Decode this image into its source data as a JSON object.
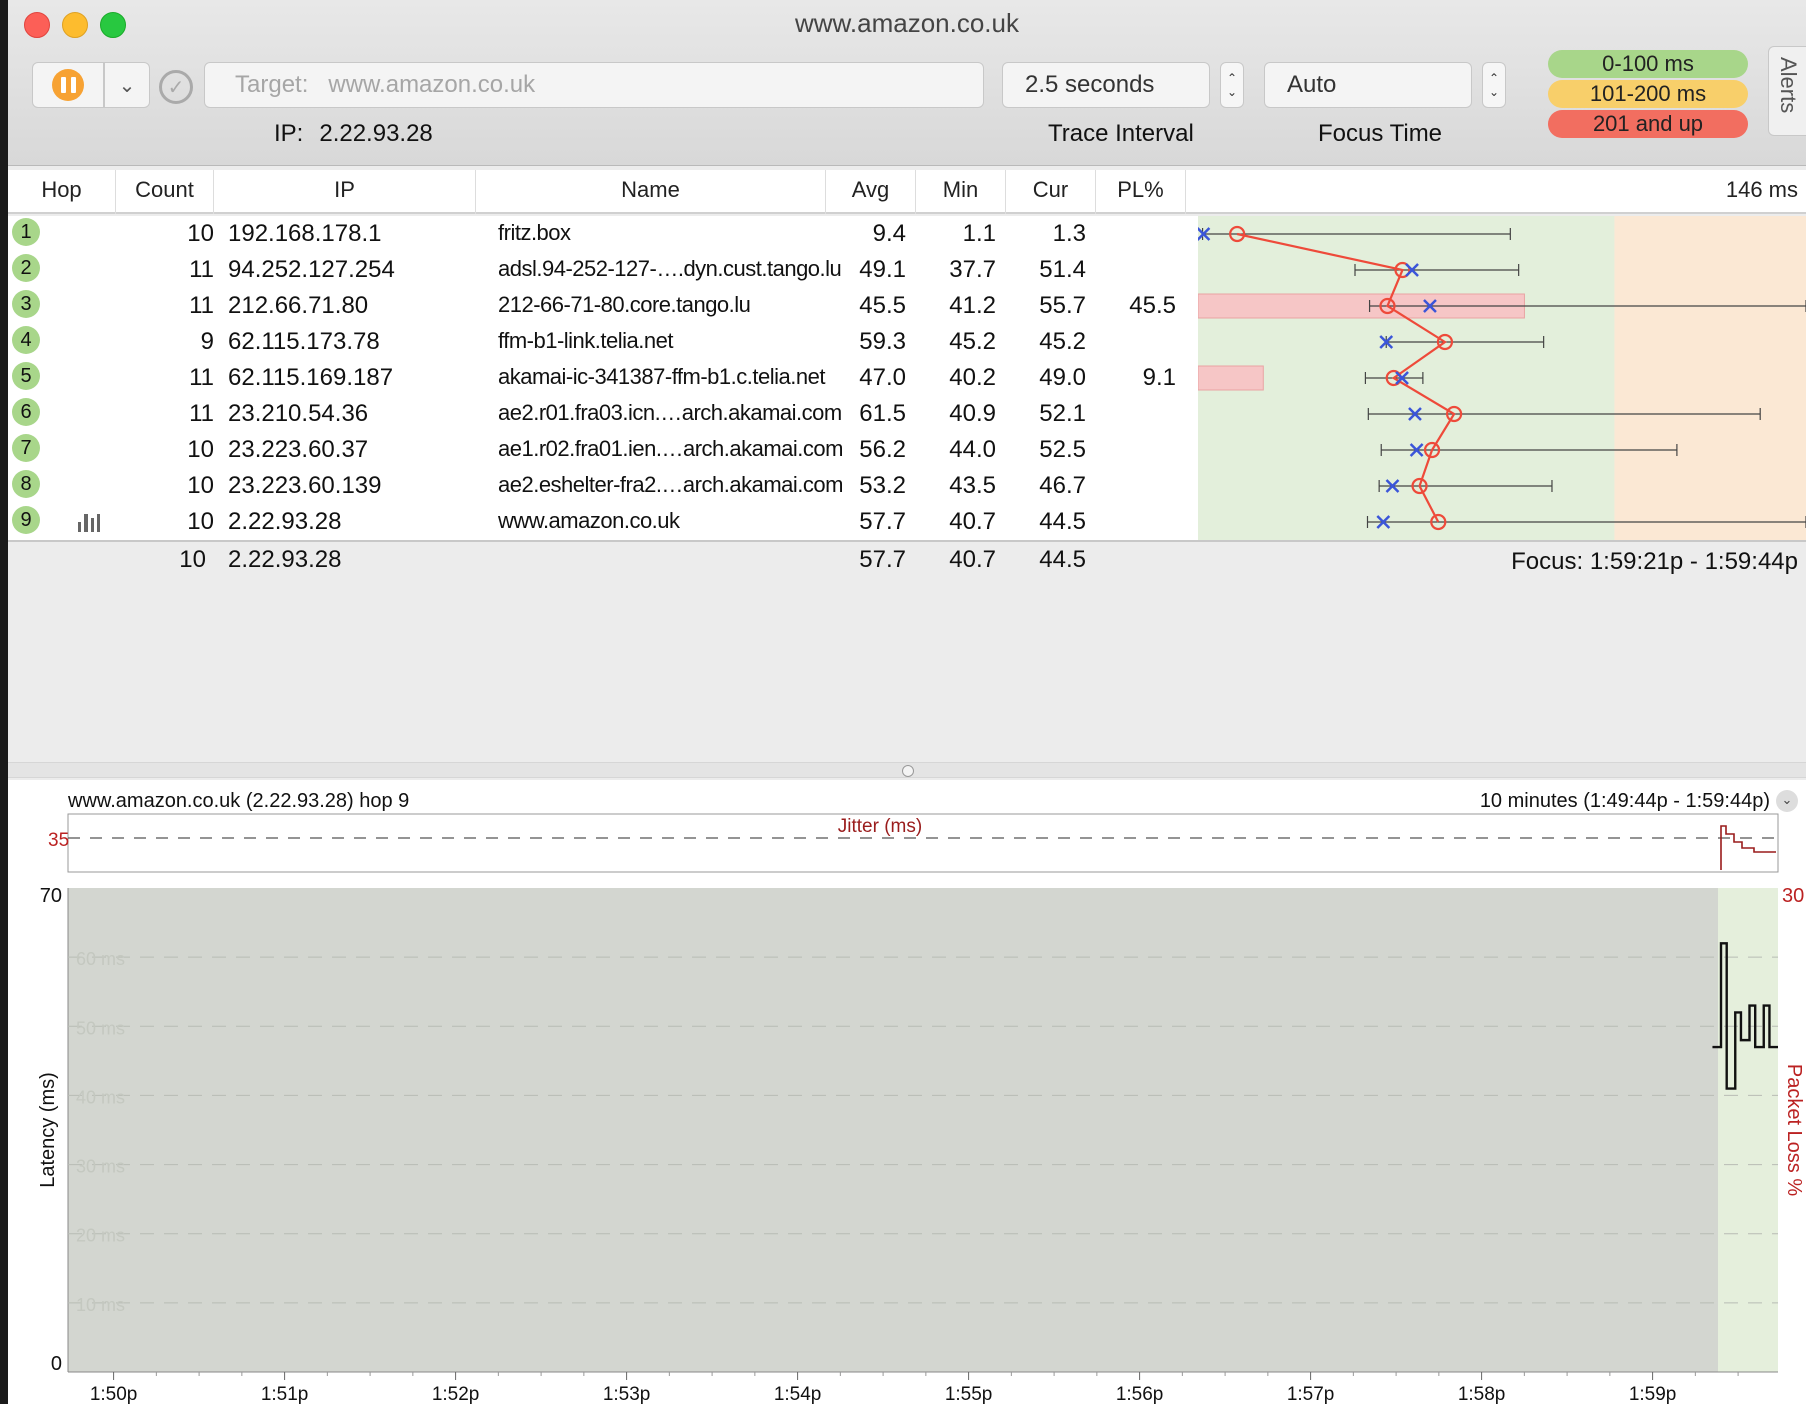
{
  "window": {
    "title": "www.amazon.co.uk"
  },
  "toolbar": {
    "target_label": "Target:",
    "target_value": "www.amazon.co.uk",
    "ip_label": "IP:",
    "ip_value": "2.22.93.28",
    "interval_value": "2.5 seconds",
    "interval_caption": "Trace Interval",
    "focus_value": "Auto",
    "focus_caption": "Focus Time",
    "legend": [
      "0-100 ms",
      "101-200 ms",
      "201 and up"
    ],
    "alerts_label": "Alerts",
    "legend_colors": {
      "good": "#a8d68a",
      "warn": "#f8cf6a",
      "bad": "#f26e60"
    }
  },
  "table": {
    "headers": [
      "Hop",
      "Count",
      "IP",
      "Name",
      "Avg",
      "Min",
      "Cur",
      "PL%"
    ],
    "scale_max_label": "146 ms",
    "rows": [
      {
        "hop": "1",
        "count": "10",
        "ip": "192.168.178.1",
        "name": "fritz.box",
        "avg": "9.4",
        "min": "1.1",
        "cur": "1.3",
        "pl": ""
      },
      {
        "hop": "2",
        "count": "11",
        "ip": "94.252.127.254",
        "name": "adsl.94-252-127-….dyn.cust.tango.lu",
        "avg": "49.1",
        "min": "37.7",
        "cur": "51.4",
        "pl": ""
      },
      {
        "hop": "3",
        "count": "11",
        "ip": "212.66.71.80",
        "name": "212-66-71-80.core.tango.lu",
        "avg": "45.5",
        "min": "41.2",
        "cur": "55.7",
        "pl": "45.5"
      },
      {
        "hop": "4",
        "count": "9",
        "ip": "62.115.173.78",
        "name": "ffm-b1-link.telia.net",
        "avg": "59.3",
        "min": "45.2",
        "cur": "45.2",
        "pl": ""
      },
      {
        "hop": "5",
        "count": "11",
        "ip": "62.115.169.187",
        "name": "akamai-ic-341387-ffm-b1.c.telia.net",
        "avg": "47.0",
        "min": "40.2",
        "cur": "49.0",
        "pl": "9.1"
      },
      {
        "hop": "6",
        "count": "11",
        "ip": "23.210.54.36",
        "name": "ae2.r01.fra03.icn.…arch.akamai.com",
        "avg": "61.5",
        "min": "40.9",
        "cur": "52.1",
        "pl": ""
      },
      {
        "hop": "7",
        "count": "10",
        "ip": "23.223.60.37",
        "name": "ae1.r02.fra01.ien.…arch.akamai.com",
        "avg": "56.2",
        "min": "44.0",
        "cur": "52.5",
        "pl": ""
      },
      {
        "hop": "8",
        "count": "10",
        "ip": "23.223.60.139",
        "name": "ae2.eshelter-fra2.…arch.akamai.com",
        "avg": "53.2",
        "min": "43.5",
        "cur": "46.7",
        "pl": ""
      },
      {
        "hop": "9",
        "count": "10",
        "ip": "2.22.93.28",
        "name": "www.amazon.co.uk",
        "avg": "57.7",
        "min": "40.7",
        "cur": "44.5",
        "pl": ""
      }
    ],
    "summary": {
      "count": "10",
      "ip": "2.22.93.28",
      "avg": "57.7",
      "min": "40.7",
      "cur": "44.5"
    },
    "focus_range": "Focus: 1:59:21p - 1:59:44p",
    "graph": {
      "scale_max_ms": 146,
      "green_until_ms": 100,
      "hops": [
        {
          "min": 1.1,
          "avg": 9.4,
          "cur": 1.3,
          "max": 75,
          "pl": 0
        },
        {
          "min": 37.7,
          "avg": 49.1,
          "cur": 51.4,
          "max": 77,
          "pl": 0
        },
        {
          "min": 41.2,
          "avg": 45.5,
          "cur": 55.7,
          "max": 146,
          "pl": 45.5
        },
        {
          "min": 45.2,
          "avg": 59.3,
          "cur": 45.2,
          "max": 83,
          "pl": 0
        },
        {
          "min": 40.2,
          "avg": 47.0,
          "cur": 49.0,
          "max": 54,
          "pl": 9.1
        },
        {
          "min": 40.9,
          "avg": 61.5,
          "cur": 52.1,
          "max": 135,
          "pl": 0
        },
        {
          "min": 44.0,
          "avg": 56.2,
          "cur": 52.5,
          "max": 115,
          "pl": 0
        },
        {
          "min": 43.5,
          "avg": 53.2,
          "cur": 46.7,
          "max": 85,
          "pl": 0
        },
        {
          "min": 40.7,
          "avg": 57.7,
          "cur": 44.5,
          "max": 146,
          "pl": 0
        }
      ]
    }
  },
  "chart": {
    "title": "www.amazon.co.uk (2.22.93.28) hop 9",
    "range": "10 minutes (1:49:44p - 1:59:44p)",
    "jitter_label": "Jitter (ms)",
    "jitter_max_label": "35",
    "latency_axis_label": "Latency (ms)",
    "packet_loss_axis_label": "Packet Loss %",
    "latency_max_label": "70",
    "latency_min_label": "0",
    "pl_max_label": "30",
    "gridline_labels": [
      "60 ms",
      "50 ms",
      "40 ms",
      "30 ms",
      "20 ms",
      "10 ms"
    ],
    "x_ticks": [
      "1:50p",
      "1:51p",
      "1:52p",
      "1:53p",
      "1:54p",
      "1:55p",
      "1:56p",
      "1:57p",
      "1:58p",
      "1:59p"
    ]
  },
  "chart_data": {
    "type": "line",
    "title": "www.amazon.co.uk (2.22.93.28) hop 9",
    "xlabel": "",
    "ylabel": "Latency (ms)",
    "y2label": "Packet Loss %",
    "ylim": [
      0,
      70
    ],
    "y2lim": [
      0,
      30
    ],
    "x_range": [
      "1:49:44p",
      "1:59:44p"
    ],
    "series": [
      {
        "x": [
          "1:59:21p",
          "1:59:24p",
          "1:59:26p",
          "1:59:29p",
          "1:59:31p",
          "1:59:34p",
          "1:59:36p",
          "1:59:39p",
          "1:59:41p",
          "1:59:44p"
        ],
        "values": [
          47,
          62,
          41,
          52,
          48,
          53,
          47,
          53,
          47,
          47
        ]
      }
    ]
  }
}
